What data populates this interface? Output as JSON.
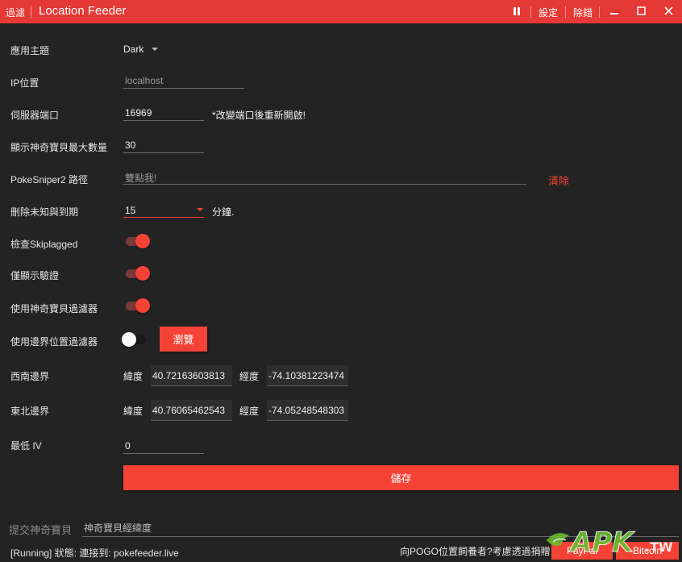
{
  "titlebar": {
    "filter_link": "過濾",
    "title": "Location Feeder",
    "pause_icon": "pause-icon",
    "settings": "設定",
    "debug": "除錯",
    "minimize_icon": "minimize-icon",
    "maximize_icon": "maximize-icon",
    "close_icon": "close-icon"
  },
  "settings": {
    "theme": {
      "label": "應用主題",
      "value": "Dark"
    },
    "ip": {
      "label": "IP位置",
      "placeholder": "localhost"
    },
    "port": {
      "label": "伺服器端口",
      "value": "16969",
      "note": "*改變端口後重新開啟!"
    },
    "max_pokemon": {
      "label": "顯示神奇寶貝最大數量",
      "value": "30"
    },
    "pokesniper_path": {
      "label": "PokeSniper2 路徑",
      "placeholder": "雙點我!",
      "clear": "清除"
    },
    "delete_unknown": {
      "label": "刪除未知與到期",
      "value": "15",
      "unit": "分鐘."
    },
    "check_skiplagged": {
      "label": "檢查Skiplagged",
      "on": true
    },
    "verified_only": {
      "label": "僅顯示驗證",
      "on": true
    },
    "pokemon_filter": {
      "label": "使用神奇寶貝過濾器",
      "on": true
    },
    "boundary_filter": {
      "label": "使用邊界位置過濾器",
      "on": false,
      "browse": "瀏覽"
    },
    "southwest": {
      "label": "西南邊界",
      "lat_label": "緯度",
      "lat": "40.72163603813",
      "lng_label": "經度",
      "lng": "-74.10381223474"
    },
    "northeast": {
      "label": "東北邊界",
      "lat_label": "緯度",
      "lat": "40.76065462543",
      "lng_label": "經度",
      "lng": "-74.05248548303"
    },
    "min_iv": {
      "label": "最低 IV",
      "value": "0"
    },
    "save": "儲存"
  },
  "footer": {
    "submit_label": "提交神奇寶貝",
    "submit_placeholder": "神奇寶貝經緯度",
    "status": "[Running]  狀態:  連接到: pokefeeder.live",
    "donate_text": "向POGO位置飼養者?考慮透過捐贈",
    "paypal": "PayPal",
    "bitcoin": "Bitcoin",
    "watermark": "APK.TW"
  },
  "colors": {
    "accent": "#f44336",
    "titlebar": "#e53935",
    "background": "#232323"
  }
}
